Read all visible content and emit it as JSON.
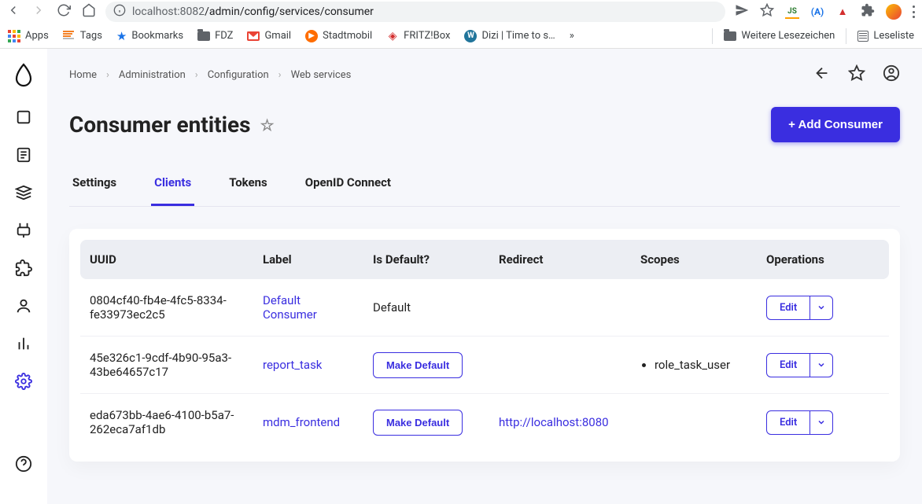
{
  "browser": {
    "url_host": "localhost",
    "url_port": ":8082",
    "url_path": "/admin/config/services/consumer",
    "bookmarks_bar": {
      "apps": "Apps",
      "tags": "Tags",
      "bookmarks": "Bookmarks",
      "fdz": "FDZ",
      "gmail": "Gmail",
      "stadtmobil": "Stadtmobil",
      "fritz": "FRITZ!Box",
      "dizi": "Dizi | Time to s…",
      "more": "»",
      "right1": "Weitere Lesezeichen",
      "right2": "Leseliste"
    }
  },
  "breadcrumb": [
    "Home",
    "Administration",
    "Configuration",
    "Web services"
  ],
  "page": {
    "title": "Consumer entities",
    "add_button": "+ Add Consumer"
  },
  "tabs": [
    {
      "label": "Settings",
      "active": false
    },
    {
      "label": "Clients",
      "active": true
    },
    {
      "label": "Tokens",
      "active": false
    },
    {
      "label": "OpenID Connect",
      "active": false
    }
  ],
  "table": {
    "headers": [
      "UUID",
      "Label",
      "Is Default?",
      "Redirect",
      "Scopes",
      "Operations"
    ],
    "op_label": "Edit",
    "make_default": "Make Default",
    "default_text": "Default",
    "rows": [
      {
        "uuid": "0804cf40-fb4e-4fc5-8334-fe33973ec2c5",
        "label": "Default Consumer",
        "is_default": true,
        "redirect": "",
        "scopes": []
      },
      {
        "uuid": "45e326c1-9cdf-4b90-95a3-43be64657c17",
        "label": "report_task",
        "is_default": false,
        "redirect": "",
        "scopes": [
          "role_task_user"
        ]
      },
      {
        "uuid": "eda673bb-4ae6-4100-b5a7-262eca7af1db",
        "label": "mdm_frontend",
        "is_default": false,
        "redirect": "http://localhost:8080",
        "scopes": []
      }
    ]
  }
}
